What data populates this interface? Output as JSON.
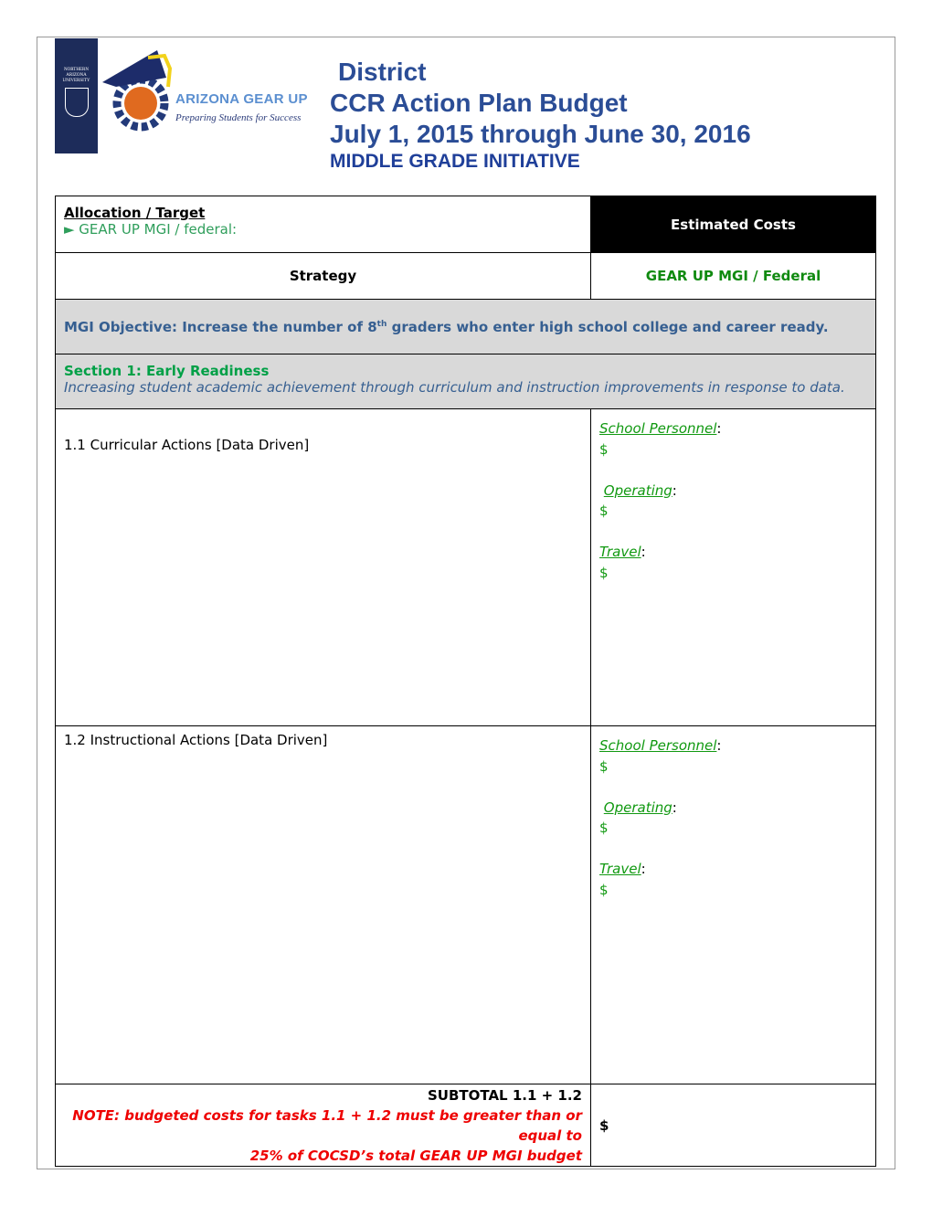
{
  "header": {
    "nau_logo_text": "NORTHERN ARIZONA UNIVERSITY",
    "logo_name": "ARIZONA GEAR UP",
    "logo_tagline": "Preparing Students for Success",
    "title_line1": "District",
    "title_line2": "CCR Action Plan Budget",
    "title_line3": "July 1, 2015 through June 30, 2016",
    "title_line4": "MIDDLE GRADE INITIATIVE"
  },
  "table": {
    "allocation_label": "Allocation / Target",
    "allocation_item": "► GEAR UP MGI / federal:",
    "estimated_costs": "Estimated Costs",
    "strategy": "Strategy",
    "funding_col": "GEAR UP MGI / Federal",
    "objective_pre": "MGI Objective: Increase the number of 8",
    "objective_sup": "th",
    "objective_post": " graders who enter high school college and career ready.",
    "section_title": "Section 1: Early Readiness",
    "section_desc": "Increasing student academic achievement through curriculum and instruction improvements in response to data.",
    "rows": [
      {
        "label": "1.1  Curricular Actions [Data Driven]"
      },
      {
        "label": "1.2  Instructional Actions [Data Driven]"
      }
    ],
    "cost_labels": {
      "personnel": "School Personnel",
      "operating": "Operating",
      "travel": "Travel",
      "colon": ":",
      "dollar": "$"
    },
    "subtotal": "SUBTOTAL 1.1 + 1.2",
    "note_line1": "NOTE: budgeted costs for tasks 1.1 + 1.2 must be greater than or equal to",
    "note_line2": "25% of COCSD’s total GEAR UP MGI budget",
    "subtotal_value": "$"
  },
  "colors": {
    "title_blue": "#2b4d96",
    "objective_blue": "#365f91",
    "section_green": "#00a046",
    "cost_green": "#119911",
    "note_red": "#ee0000"
  }
}
